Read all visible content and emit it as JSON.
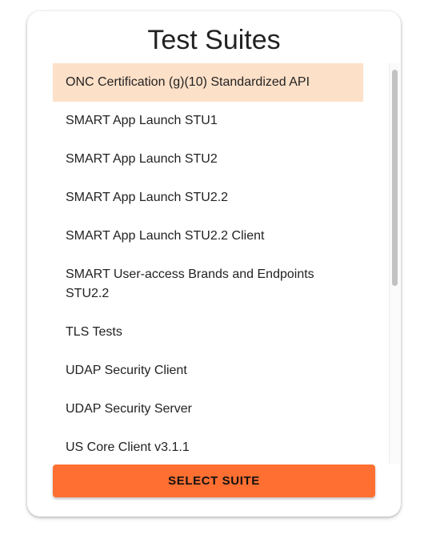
{
  "dialog": {
    "title": "Test Suites"
  },
  "suites": {
    "selected_index": 0,
    "items": [
      {
        "label": "ONC Certification (g)(10) Standardized API"
      },
      {
        "label": "SMART App Launch STU1"
      },
      {
        "label": "SMART App Launch STU2"
      },
      {
        "label": "SMART App Launch STU2.2"
      },
      {
        "label": "SMART App Launch STU2.2 Client"
      },
      {
        "label": "SMART User-access Brands and Endpoints STU2.2"
      },
      {
        "label": "TLS Tests"
      },
      {
        "label": "UDAP Security Client"
      },
      {
        "label": "UDAP Security Server"
      },
      {
        "label": "US Core Client v3.1.1"
      }
    ]
  },
  "actions": {
    "select_label": "SELECT SUITE"
  },
  "colors": {
    "accent": "#ff6f31",
    "selected_background": "#fde0c8"
  }
}
